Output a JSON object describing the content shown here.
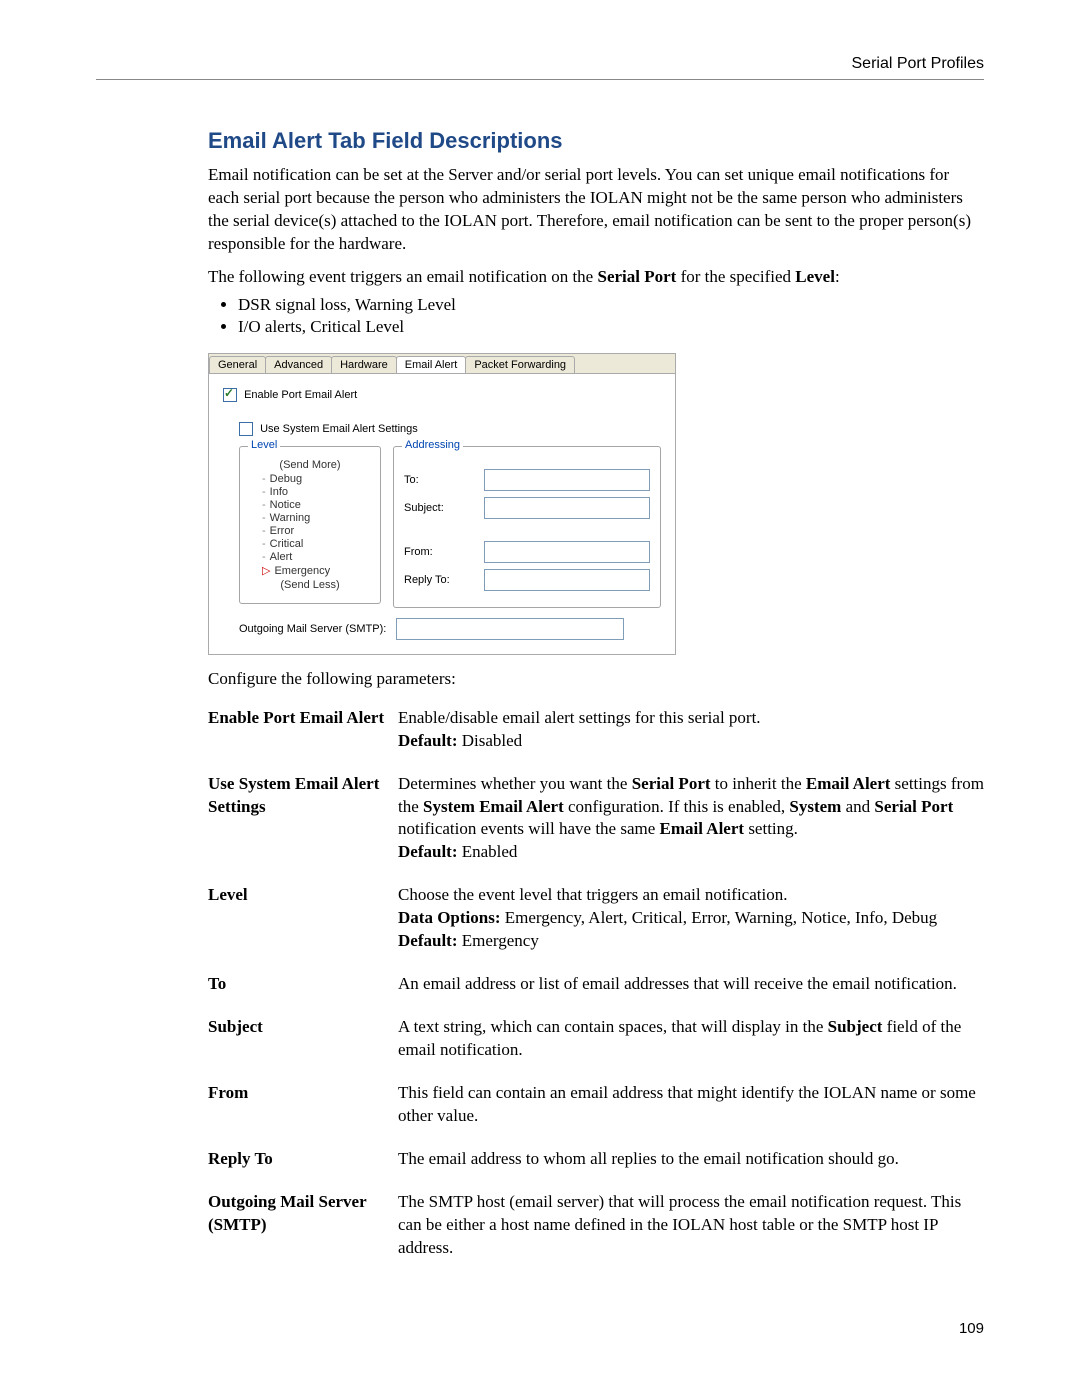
{
  "header": {
    "title": "Serial Port Profiles"
  },
  "section": {
    "title": "Email Alert Tab Field Descriptions",
    "intro": "Email notification can be set at the Server and/or serial port levels. You can set unique email notifications for each serial port because the person who administers the IOLAN might not be the same person who administers the serial device(s) attached to the IOLAN port. Therefore, email notification can be sent to the proper person(s) responsible for the hardware.",
    "trigger_pre": "The following event triggers an email notification on the ",
    "trigger_b1": "Serial Port",
    "trigger_mid": " for the specified ",
    "trigger_b2": "Level",
    "trigger_post": ":",
    "bullets": [
      "DSR signal loss, Warning Level",
      "I/O alerts, Critical Level"
    ],
    "configure": "Configure the following parameters:"
  },
  "dialog": {
    "tabs": [
      "General",
      "Advanced",
      "Hardware",
      "Email Alert",
      "Packet Forwarding"
    ],
    "active_tab": "Email Alert",
    "enable_label": "Enable Port Email Alert",
    "enable_checked": true,
    "use_system_label": "Use System Email Alert Settings",
    "use_system_checked": false,
    "level": {
      "legend": "Level",
      "send_more": "(Send More)",
      "items": [
        "Debug",
        "Info",
        "Notice",
        "Warning",
        "Error",
        "Critical",
        "Alert",
        "Emergency"
      ],
      "pointer": "Emergency",
      "send_less": "(Send Less)"
    },
    "addressing": {
      "legend": "Addressing",
      "to": "To:",
      "subject": "Subject:",
      "from": "From:",
      "reply_to": "Reply To:"
    },
    "smtp_label": "Outgoing Mail Server (SMTP):"
  },
  "fields": [
    {
      "label": "Enable Port Email Alert",
      "desc": "Enable/disable email alert settings for this serial port.",
      "default_label": "Default:",
      "default_val": " Disabled"
    },
    {
      "label": "Use System Email Alert Settings",
      "desc_pre": "Determines whether you want the ",
      "b1": "Serial Port",
      "desc_mid1": " to inherit the ",
      "b2": "Email Alert",
      "desc_mid2": " settings from the ",
      "b3": "System Email Alert",
      "desc_mid3": " configuration. If this is enabled, ",
      "b4": "System",
      "desc_mid4": " and ",
      "b5": "Serial Port",
      "desc_mid5": " notification events will have the same ",
      "b6": "Email Alert",
      "desc_end": " setting.",
      "default_label": "Default:",
      "default_val": " Enabled"
    },
    {
      "label": "Level",
      "desc": "Choose the event level that triggers an email notification.",
      "opts_label": "Data Options:",
      "opts_val": " Emergency, Alert, Critical, Error, Warning, Notice, Info, Debug",
      "default_label": "Default:",
      "default_val": " Emergency"
    },
    {
      "label": "To",
      "desc": "An email address or list of email addresses that will receive the email notification."
    },
    {
      "label": "Subject",
      "desc_pre": "A text string, which can contain spaces, that will display in the ",
      "b1": "Subject",
      "desc_end": " field of the email notification."
    },
    {
      "label": "From",
      "desc": "This field can contain an email address that might identify the IOLAN name or some other value."
    },
    {
      "label": "Reply To",
      "desc": "The email address to whom all replies to the email notification should go."
    },
    {
      "label": "Outgoing Mail Server (SMTP)",
      "desc": "The SMTP host (email server) that will process the email notification request. This can be either a host name defined in the IOLAN host table or the SMTP host IP address."
    }
  ],
  "page_number": "109"
}
